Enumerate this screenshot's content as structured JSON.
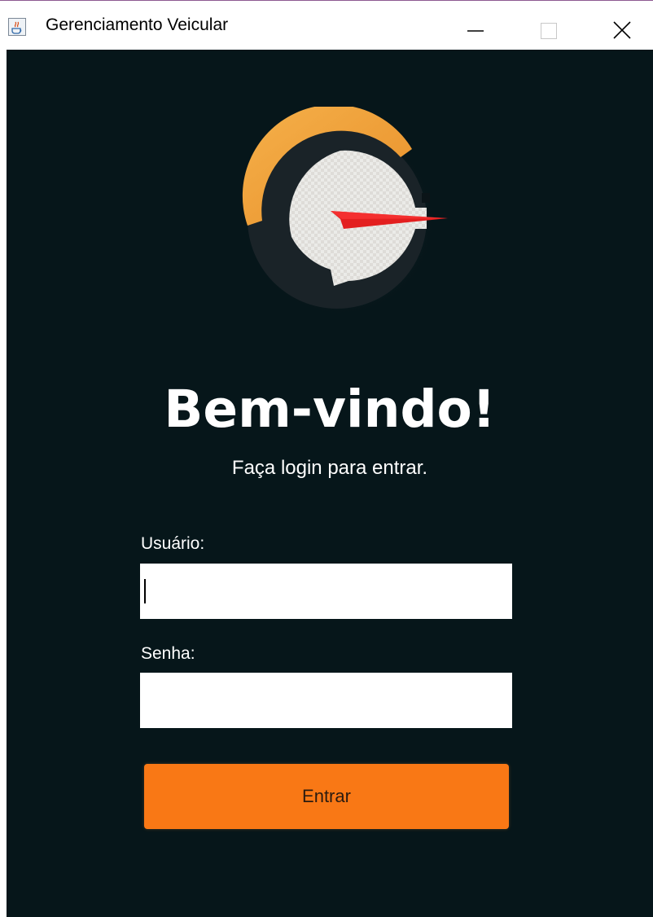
{
  "window": {
    "title": "Gerenciamento Veicular",
    "app_icon": "java-cup-icon",
    "controls": [
      "minimize-icon",
      "maximize-icon",
      "close-icon"
    ]
  },
  "logo": {
    "icon": "speedometer-gauge-icon",
    "colors": {
      "arc": "#f0a43a",
      "dial": "#e9e8e4",
      "needle": "#e31f1f",
      "ring": "#1a2227"
    }
  },
  "welcome": {
    "title": "Bem-vindo!",
    "subtitle": "Faça login para entrar."
  },
  "form": {
    "username_label": "Usuário:",
    "username_value": "",
    "password_label": "Senha:",
    "password_value": "",
    "submit_label": "Entrar"
  },
  "colors": {
    "background": "#06161a",
    "accent": "#f97815",
    "text": "#ffffff"
  }
}
